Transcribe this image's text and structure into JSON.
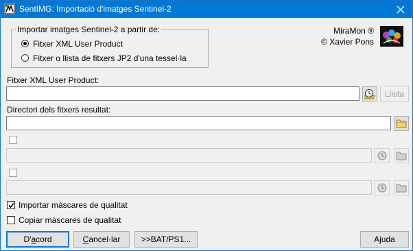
{
  "window": {
    "title": "SentIMG: Importació d'imatges Sentinel-2",
    "close_symbol": "✕"
  },
  "source_group": {
    "legend": "Importar imatges Sentinel-2 a partir de:",
    "options": [
      {
        "label": "Fitxer XML User Product",
        "selected": true
      },
      {
        "label": "Fitxer o llista de fitxers JP2 d'una tessel·la",
        "selected": false
      }
    ]
  },
  "branding": {
    "app": "MiraMon ®",
    "author": "© Xavier Pons"
  },
  "xml_field": {
    "label": "Fitxer XML User Product:",
    "value": "",
    "list_button": "Llista"
  },
  "output_dir": {
    "label": "Directori dels fitxers resultat:",
    "value": ""
  },
  "optional_row_1": {
    "checked": false,
    "value": ""
  },
  "optional_row_2": {
    "checked": false,
    "value": ""
  },
  "quality_import": {
    "label": "Importar màscares de qualitat",
    "checked": true
  },
  "quality_copy": {
    "label": "Copiar màscares de qualitat",
    "checked": false
  },
  "buttons": {
    "ok_pre": "D'",
    "ok_key": "a",
    "ok_post": "cord",
    "cancel_key": "C",
    "cancel_post": "ancel·lar",
    "bat": ">>BAT/PS1...",
    "help": "Ajuda"
  },
  "icons": {
    "close": "close-icon",
    "app": "app-icon",
    "logo": "miramon-logo-icon",
    "clock_folder": "clock-folder-icon",
    "folder": "folder-icon"
  },
  "colors": {
    "titlebar": "#0078d7",
    "window_bg": "#f0f0f0",
    "default_border": "#0078d7"
  }
}
